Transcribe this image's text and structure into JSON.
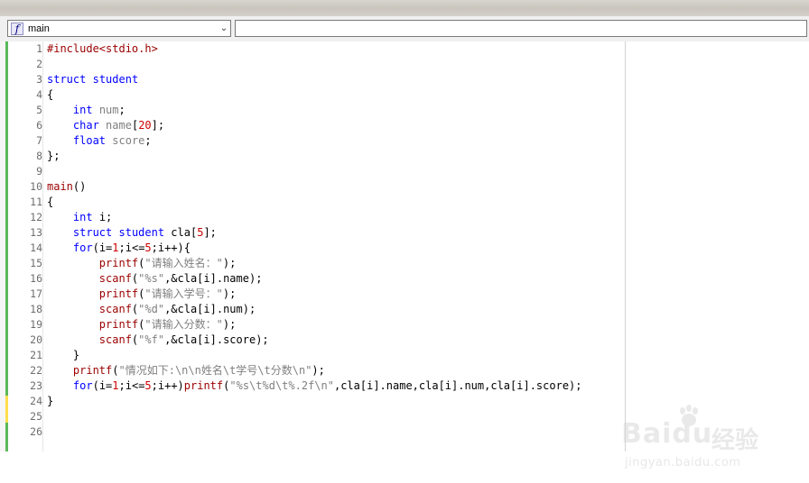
{
  "toolbar": {
    "function_combo_value": "main",
    "function_combo_icon": "function-icon",
    "dropdown_icon": "chevron-down-icon",
    "symbol_combo_value": ""
  },
  "editor": {
    "line_numbers": [
      "1",
      "2",
      "3",
      "4",
      "5",
      "6",
      "7",
      "8",
      "9",
      "10",
      "11",
      "12",
      "13",
      "14",
      "15",
      "16",
      "17",
      "18",
      "19",
      "20",
      "21",
      "22",
      "23",
      "24",
      "25",
      "26"
    ],
    "lines": [
      "#include<stdio.h>",
      "",
      "struct student",
      "{",
      "    int num;",
      "    char name[20];",
      "    float score;",
      "};",
      "",
      "main()",
      "{",
      "    int i;",
      "    struct student cla[5];",
      "    for(i=1;i<=5;i++){",
      "        printf(\"请输入姓名：\");",
      "        scanf(\"%s\",&cla[i].name);",
      "        printf(\"请输入学号：\");",
      "        scanf(\"%d\",&cla[i].num);",
      "        printf(\"请输入分数：\");",
      "        scanf(\"%f\",&cla[i].score);",
      "    }",
      "    printf(\"情况如下:\\n\\n姓名\\t学号\\t分数\\n\");",
      "    for(i=1;i<=5;i++)printf(\"%s\\t%d\\t%.2f\\n\",cla[i].name,cla[i].num,cla[i].score);",
      "}",
      "",
      ""
    ]
  },
  "watermark": {
    "brand": "Bai",
    "brand2": "du",
    "cn": "经验",
    "url": "jingyan.baidu.com"
  },
  "colors": {
    "keyword": "#0000ff",
    "function": "#9b0000",
    "string": "#808080",
    "number": "#cc0000",
    "change_bar": "#5cb85c"
  }
}
